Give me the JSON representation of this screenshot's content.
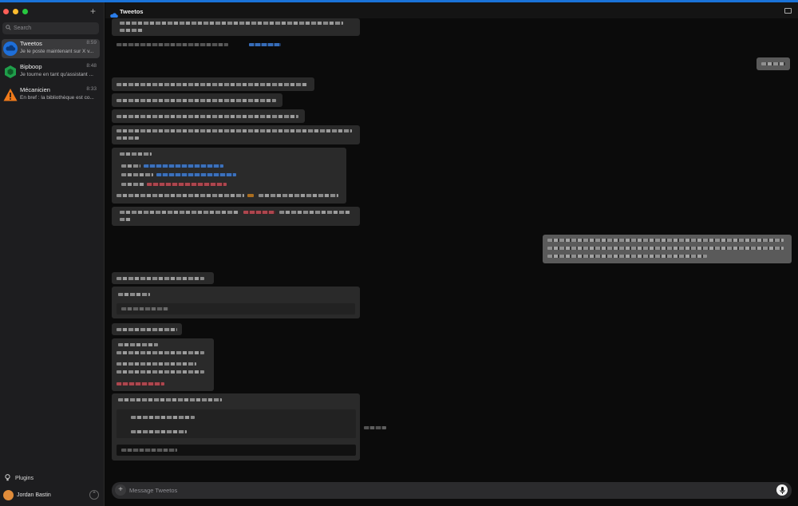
{
  "app": {
    "accent": "#1a73d9"
  },
  "sidebar": {
    "search_placeholder": "Search",
    "new_chat_label": "+",
    "conversations": [
      {
        "name": "Tweetos",
        "time": "8:59",
        "snippet": "Je le poste maintenant sur X v...",
        "icon": "cloud-icon",
        "color": "#1e6fd9",
        "active": true
      },
      {
        "name": "Bipboop",
        "time": "8:48",
        "snippet": "Je tourne en tant qu'assistant ...",
        "icon": "hexagon-icon",
        "color": "#1f9e4a",
        "active": false
      },
      {
        "name": "Mécanicien",
        "time": "8:33",
        "snippet": "En bref : la bibliothèque est co...",
        "icon": "warning-icon",
        "color": "#f07a1a",
        "active": false
      }
    ],
    "plugins_label": "Plugins",
    "user_name": "Jordan Bastin"
  },
  "header": {
    "title": "Tweetos"
  },
  "composer": {
    "placeholder": "Message Tweetos"
  }
}
